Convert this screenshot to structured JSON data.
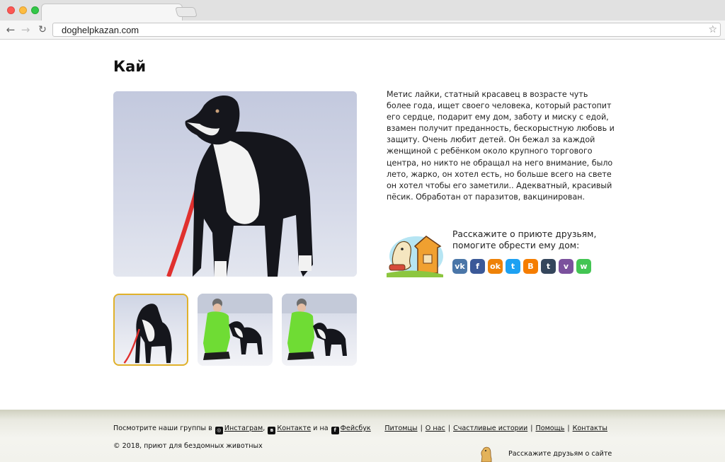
{
  "browser": {
    "url": "doghelpkazan.com",
    "icons": {
      "back": "arrow-left-icon",
      "forward": "arrow-right-icon",
      "reload": "reload-icon",
      "bookmark": "star-icon"
    }
  },
  "page": {
    "title": "Кай",
    "description": "Метис лайки, статный красавец в возрасте чуть более года, ищет своего человека, который растопит его сердце, подарит ему дом, заботу и миску с едой, взамен получит преданность, бескорыстную любовь и защиту. Очень любит детей. Он бежал за каждой женщиной с ребёнком около крупного торгового центра, но никто не обращал на него внимание, было лето, жарко, он хотел есть, но больше всего на свете он хотел чтобы его заметили.. Адекватный, красивый пёсик. Обработан от паразитов, вакцинирован.",
    "share_prompt": "Расскажите о приюте друзьям, помогите обрести ему дом:",
    "share_buttons": [
      {
        "name": "vk",
        "glyph": "vk",
        "color": "#4a76a8"
      },
      {
        "name": "facebook",
        "glyph": "f",
        "color": "#3b5998"
      },
      {
        "name": "odnoklassniki",
        "glyph": "ok",
        "color": "#ee8208"
      },
      {
        "name": "twitter",
        "glyph": "t",
        "color": "#1da1f2"
      },
      {
        "name": "blogger",
        "glyph": "B",
        "color": "#f57d00"
      },
      {
        "name": "tumblr",
        "glyph": "t",
        "color": "#35465c"
      },
      {
        "name": "viber",
        "glyph": "v",
        "color": "#7b519d"
      },
      {
        "name": "whatsapp",
        "glyph": "w",
        "color": "#43c553"
      }
    ],
    "thumbnails": [
      {
        "label": "dog-standing"
      },
      {
        "label": "woman-with-dog"
      },
      {
        "label": "woman-with-dog-2"
      }
    ]
  },
  "footer": {
    "groups_prefix": "Посмотрите наши группы в",
    "instagram": "Инстаграм",
    "vk": "Контакте",
    "and_on": "и на",
    "facebook": "Фейсбук",
    "nav": [
      "Питомцы",
      "О нас",
      "Счастливые истории",
      "Помощь",
      "Контакты"
    ],
    "copyright": "© 2018, приют для бездомных животных",
    "share_text": "Расскажите друзьям о сайте"
  }
}
